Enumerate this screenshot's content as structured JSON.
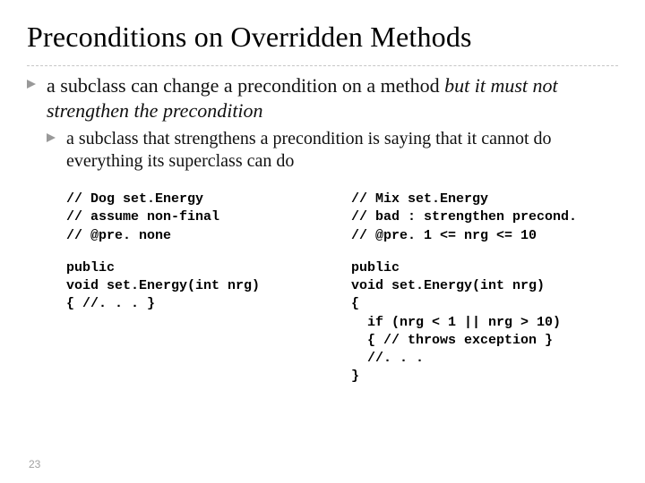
{
  "title": "Preconditions on Overridden Methods",
  "bullet": {
    "text_prefix": "a subclass can change a precondition on a method ",
    "text_italic": "but it must not strengthen the precondition",
    "sub": {
      "text": "a subclass that strengthens a precondition is saying that it cannot do everything its superclass can do"
    }
  },
  "code": {
    "left": {
      "block1": "// Dog set.Energy\n// assume non-final\n// @pre. none",
      "block2": "public\nvoid set.Energy(int nrg)\n{ //. . . }"
    },
    "right": {
      "block1": "// Mix set.Energy\n// bad : strengthen precond.\n// @pre. 1 <= nrg <= 10",
      "block2": "public\nvoid set.Energy(int nrg)\n{\n  if (nrg < 1 || nrg > 10)\n  { // throws exception }\n  //. . .\n}"
    }
  },
  "page_number": "23"
}
